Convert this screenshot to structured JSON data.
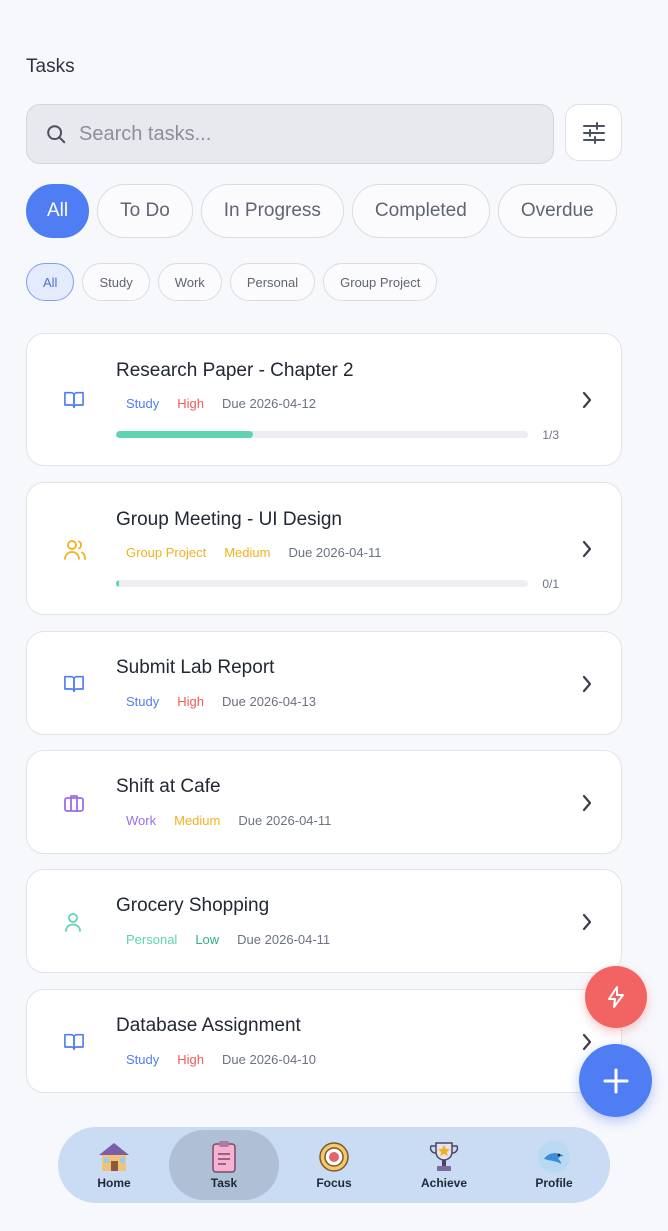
{
  "header": {
    "title": "Tasks"
  },
  "search": {
    "placeholder": "Search tasks..."
  },
  "status_tabs": [
    "All",
    "To Do",
    "In Progress",
    "Completed",
    "Overdue"
  ],
  "category_tabs": [
    "All",
    "Study",
    "Work",
    "Personal",
    "Group Project"
  ],
  "tasks": [
    {
      "title": "Research Paper - Chapter 2",
      "category": "Study",
      "priority": "High",
      "due": "Due 2026-04-12",
      "icon": "book-icon",
      "progress": "1/3",
      "progress_fraction": 0.333
    },
    {
      "title": "Group Meeting - UI Design",
      "category": "Group Project",
      "priority": "Medium",
      "due": "Due 2026-04-11",
      "icon": "users-icon",
      "progress": "0/1",
      "progress_fraction": 0
    },
    {
      "title": "Submit Lab Report",
      "category": "Study",
      "priority": "High",
      "due": "Due 2026-04-13",
      "icon": "book-icon"
    },
    {
      "title": "Shift at Cafe",
      "category": "Work",
      "priority": "Medium",
      "due": "Due 2026-04-11",
      "icon": "briefcase-icon"
    },
    {
      "title": "Grocery Shopping",
      "category": "Personal",
      "priority": "Low",
      "due": "Due 2026-04-11",
      "icon": "user-icon"
    },
    {
      "title": "Database Assignment",
      "category": "Study",
      "priority": "High",
      "due": "Due 2026-04-10",
      "icon": "book-icon"
    }
  ],
  "nav": {
    "items": [
      {
        "label": "Home",
        "icon": "house-icon"
      },
      {
        "label": "Task",
        "icon": "clipboard-icon"
      },
      {
        "label": "Focus",
        "icon": "target-icon"
      },
      {
        "label": "Achieve",
        "icon": "trophy-icon"
      },
      {
        "label": "Profile",
        "icon": "bird-avatar-icon"
      }
    ]
  },
  "colors": {
    "accent": "#4f7df3",
    "high": "#ef5a5a",
    "medium": "#f2b01e",
    "low": "#2fb07f",
    "progress": "#5fd4b2",
    "fab_secondary": "#f26464"
  }
}
